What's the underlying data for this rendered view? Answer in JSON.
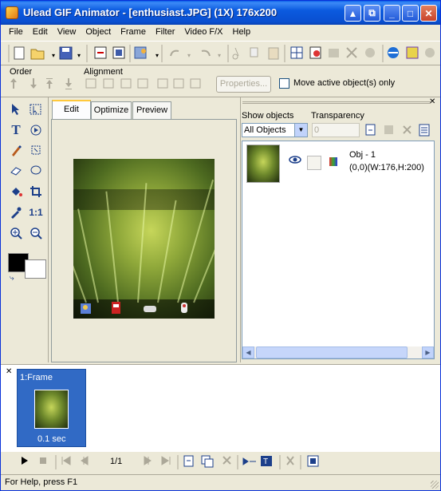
{
  "window": {
    "title": "Ulead GIF Animator - [enthusiast.JPG] (1X) 176x200",
    "minimize": "▲",
    "restore": "⧉",
    "min": "_",
    "max": "□",
    "close": "✕"
  },
  "menu": [
    "File",
    "Edit",
    "View",
    "Object",
    "Frame",
    "Filter",
    "Video F/X",
    "Help"
  ],
  "toolbar2": {
    "order_label": "Order",
    "alignment_label": "Alignment",
    "properties_label": "Properties...",
    "move_active_label": "Move active object(s) only"
  },
  "palette": {
    "text_tool": "T",
    "one_to_one": "1:1"
  },
  "edit_tabs": [
    "Edit",
    "Optimize",
    "Preview"
  ],
  "objects": {
    "show_objects_label": "Show objects",
    "transparency_label": "Transparency",
    "show_objects_value": "All Objects",
    "transparency_value": "0",
    "items": [
      {
        "name": "Obj - 1",
        "geometry": "(0,0)(W:176,H:200)"
      }
    ]
  },
  "frames": {
    "items": [
      {
        "label": "1:Frame",
        "delay": "0.1 sec"
      }
    ],
    "counter": "1/1"
  },
  "status": "For Help, press F1",
  "colors": {
    "titlebar": "#0a4fd0",
    "window_bg": "#ece9d8",
    "frame_selected": "#316ac5"
  }
}
